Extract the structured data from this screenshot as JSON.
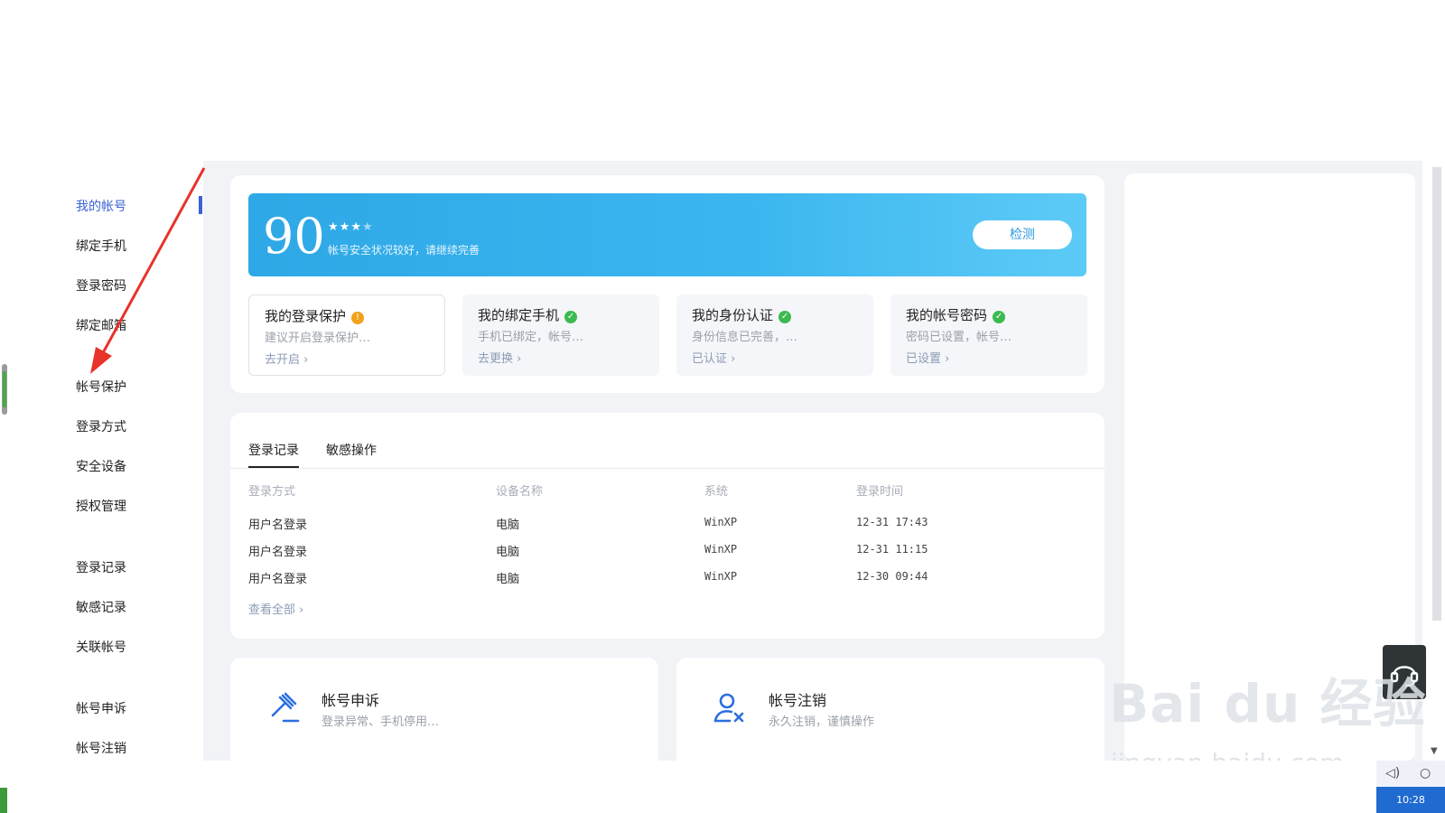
{
  "sidebar": {
    "items": [
      {
        "label": "我的帐号",
        "active": true
      },
      {
        "label": "绑定手机"
      },
      {
        "label": "登录密码"
      },
      {
        "label": "绑定邮箱"
      },
      {
        "label": "帐号保护"
      },
      {
        "label": "登录方式"
      },
      {
        "label": "安全设备"
      },
      {
        "label": "授权管理"
      },
      {
        "label": "登录记录"
      },
      {
        "label": "敏感记录"
      },
      {
        "label": "关联帐号"
      },
      {
        "label": "帐号申诉"
      },
      {
        "label": "帐号注销"
      }
    ]
  },
  "score": {
    "value": "90",
    "stars_filled": 3,
    "stars_total": 4,
    "description": "帐号安全状况较好，请继续完善",
    "detect_label": "检测"
  },
  "security_cards": [
    {
      "title": "我的登录保护",
      "status": "warn",
      "desc": "建议开启登录保护…",
      "link": "去开启"
    },
    {
      "title": "我的绑定手机",
      "status": "ok",
      "desc": "手机已绑定，帐号…",
      "link": "去更换"
    },
    {
      "title": "我的身份认证",
      "status": "ok",
      "desc": "身份信息已完善，…",
      "link": "已认证"
    },
    {
      "title": "我的帐号密码",
      "status": "ok",
      "desc": "密码已设置，帐号…",
      "link": "已设置"
    }
  ],
  "tabs": [
    "登录记录",
    "敏感操作"
  ],
  "login_table": {
    "headers": [
      "登录方式",
      "设备名称",
      "系统",
      "登录时间"
    ],
    "rows": [
      [
        "用户名登录",
        "电脑",
        "WinXP",
        "12-31 17:43"
      ],
      [
        "用户名登录",
        "电脑",
        "WinXP",
        "12-31 11:15"
      ],
      [
        "用户名登录",
        "电脑",
        "WinXP",
        "12-30 09:44"
      ]
    ],
    "view_all": "查看全部"
  },
  "bottom_cards": [
    {
      "title": "帐号申诉",
      "desc": "登录异常、手机停用…",
      "icon": "gavel-icon"
    },
    {
      "title": "帐号注销",
      "desc": "永久注销，谨慎操作",
      "icon": "user-remove-icon"
    }
  ],
  "taskbar": {
    "time": "10:28"
  },
  "watermark": {
    "brand": "Bai du 经验",
    "url": "jingyan.baidu.com"
  },
  "colors": {
    "accent": "#3b62d6",
    "banner": "#3cb6ef",
    "warn": "#f2a21a",
    "ok": "#3cba4f"
  }
}
